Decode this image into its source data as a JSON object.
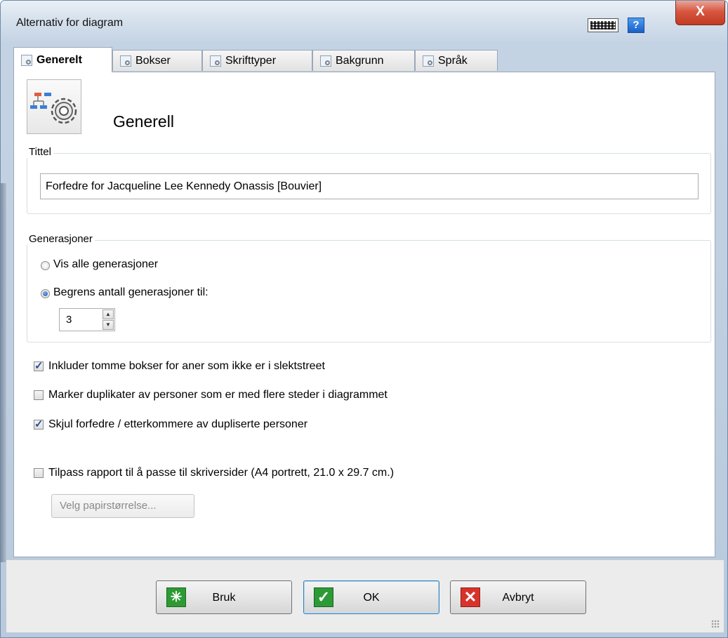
{
  "window": {
    "title": "Alternativ for diagram",
    "help_label": "?",
    "close_label": "X"
  },
  "tabs": [
    {
      "label": "Generelt",
      "active": true
    },
    {
      "label": "Bokser",
      "active": false
    },
    {
      "label": "Skrifttyper",
      "active": false
    },
    {
      "label": "Bakgrunn",
      "active": false
    },
    {
      "label": "Språk",
      "active": false
    }
  ],
  "section": {
    "heading": "Generell",
    "icon": "chart-settings-gear-icon"
  },
  "title_group": {
    "label": "Tittel",
    "value": "Forfedre for Jacqueline Lee Kennedy Onassis [Bouvier]"
  },
  "generations": {
    "label": "Generasjoner",
    "show_all_label": "Vis alle generasjoner",
    "show_all_selected": false,
    "limit_label": "Begrens antall generasjoner til:",
    "limit_selected": true,
    "limit_value": "3"
  },
  "options": [
    {
      "label": "Inkluder tomme bokser for aner som ikke er i slektstreet",
      "checked": true
    },
    {
      "label": "Marker duplikater av personer som er med flere steder i diagrammet",
      "checked": false
    },
    {
      "label": "Skjul forfedre / etterkommere av dupliserte personer",
      "checked": true
    },
    {
      "label": "Tilpass rapport til å passe til skriversider (A4 portrett, 21.0 x 29.7 cm.)",
      "checked": false
    }
  ],
  "paper_size_button": {
    "label": "Velg papirstørrelse...",
    "enabled": false
  },
  "footer": {
    "apply_label": "Bruk",
    "ok_label": "OK",
    "cancel_label": "Avbryt"
  },
  "colors": {
    "apply_icon": "#2e9a35",
    "ok_icon": "#2c9a36",
    "cancel_icon": "#d8332b",
    "close_button": "#c23b22"
  }
}
